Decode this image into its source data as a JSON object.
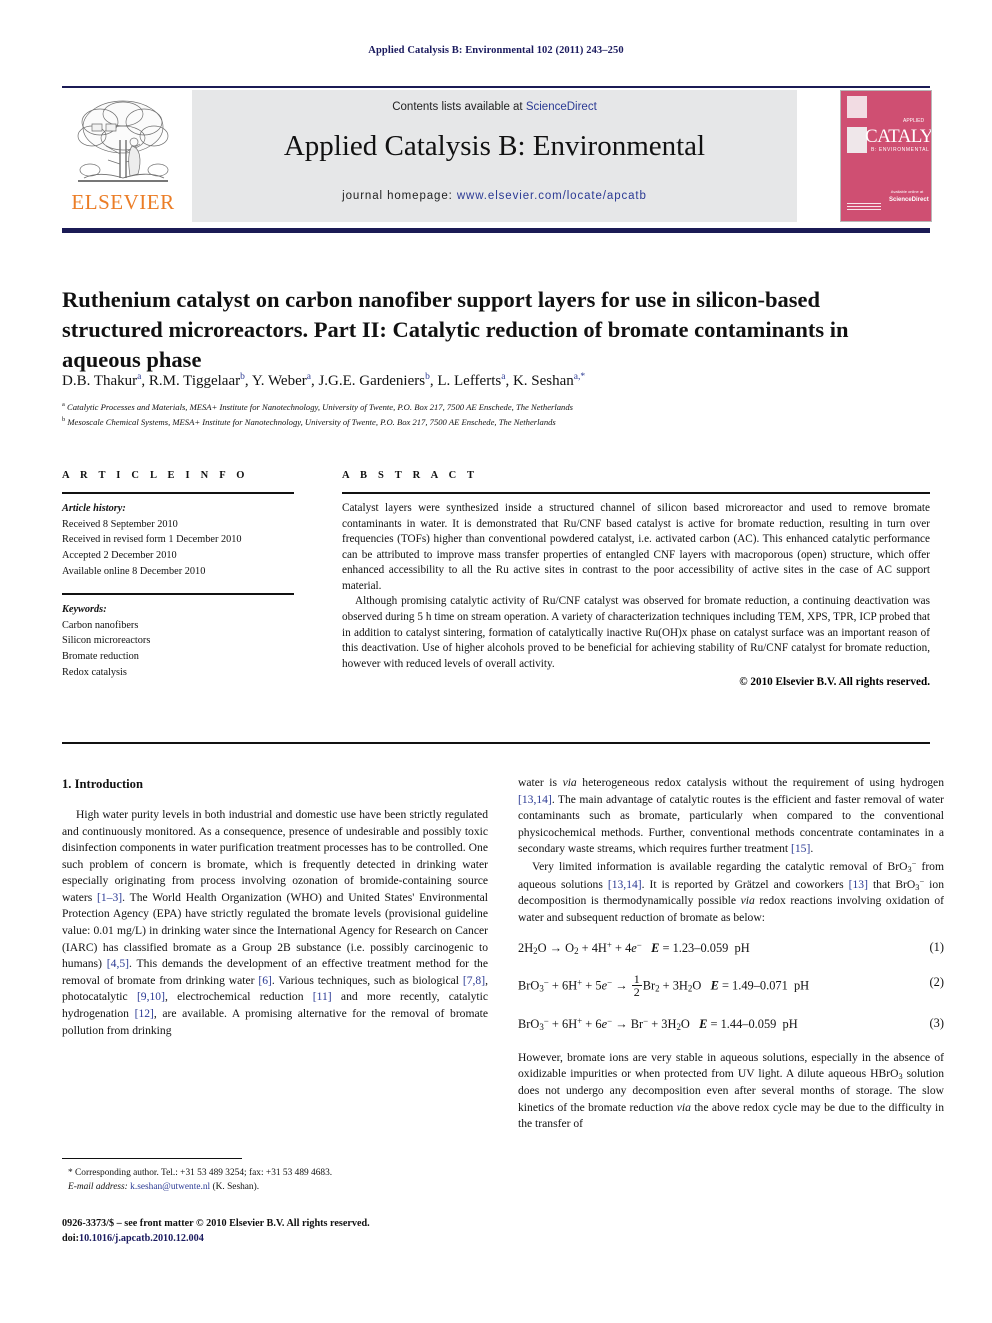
{
  "running_head": "Applied Catalysis B: Environmental 102 (2011) 243–250",
  "masthead": {
    "contents_prefix": "Contents lists available at ",
    "contents_link": "ScienceDirect",
    "journal_title": "Applied Catalysis B: Environmental",
    "homepage_prefix": "journal homepage: ",
    "homepage_url": "www.elsevier.com/locate/apcatb",
    "publisher": "ELSEVIER",
    "cover": {
      "title": "CATALYSIS",
      "applied": "APPLIED",
      "subtitle": "B: ENVIRONMENTAL",
      "available_at": "Available online at",
      "sciencedirect": "ScienceDirect"
    },
    "rule_color": "#1b1b55",
    "band_color": "#e6e7e8",
    "link_color": "#2b3a94",
    "elsevier_orange": "#eb7d26",
    "cover_pink": "#cf4f72"
  },
  "article": {
    "title": "Ruthenium catalyst on carbon nanofiber support layers for use in silicon-based structured microreactors. Part II: Catalytic reduction of bromate contaminants in aqueous phase",
    "authors": [
      {
        "name": "D.B. Thakur",
        "marks": "a"
      },
      {
        "name": "R.M. Tiggelaar",
        "marks": "b"
      },
      {
        "name": "Y. Weber",
        "marks": "a"
      },
      {
        "name": "J.G.E. Gardeniers",
        "marks": "b"
      },
      {
        "name": "L. Lefferts",
        "marks": "a"
      },
      {
        "name": "K. Seshan",
        "marks": "a,*"
      }
    ],
    "affiliations": [
      {
        "mark": "a",
        "text": "Catalytic Processes and Materials, MESA+ Institute for Nanotechnology, University of Twente, P.O. Box 217, 7500 AE Enschede, The Netherlands"
      },
      {
        "mark": "b",
        "text": "Mesoscale Chemical Systems, MESA+ Institute for Nanotechnology, University of Twente, P.O. Box 217, 7500 AE Enschede, The Netherlands"
      }
    ]
  },
  "article_info": {
    "heading": "A R T I C L E  I N F O",
    "history_label": "Article history:",
    "history": [
      "Received 8 September 2010",
      "Received in revised form 1 December 2010",
      "Accepted 2 December 2010",
      "Available online 8 December 2010"
    ],
    "keywords_label": "Keywords:",
    "keywords": [
      "Carbon nanofibers",
      "Silicon microreactors",
      "Bromate reduction",
      "Redox catalysis"
    ]
  },
  "abstract": {
    "heading": "A B S T R A C T",
    "para1": "Catalyst layers were synthesized inside a structured channel of silicon based microreactor and used to remove bromate contaminants in water. It is demonstrated that Ru/CNF based catalyst is active for bromate reduction, resulting in turn over frequencies (TOFs) higher than conventional powdered catalyst, i.e. activated carbon (AC). This enhanced catalytic performance can be attributed to improve mass transfer properties of entangled CNF layers with macroporous (open) structure, which offer enhanced accessibility to all the Ru active sites in contrast to the poor accessibility of active sites in the case of AC support material.",
    "para2": "Although promising catalytic activity of Ru/CNF catalyst was observed for bromate reduction, a continuing deactivation was observed during 5 h time on stream operation. A variety of characterization techniques including TEM, XPS, TPR, ICP probed that in addition to catalyst sintering, formation of catalytically inactive Ru(OH)x phase on catalyst surface was an important reason of this deactivation. Use of higher alcohols proved to be beneficial for achieving stability of Ru/CNF catalyst for bromate reduction, however with reduced levels of overall activity.",
    "copyright": "© 2010 Elsevier B.V. All rights reserved."
  },
  "body": {
    "section_heading": "1.  Introduction",
    "left_para1": "High water purity levels in both industrial and domestic use have been strictly regulated and continuously monitored. As a consequence, presence of undesirable and possibly toxic disinfection components in water purification treatment processes has to be controlled. One such problem of concern is bromate, which is frequently detected in drinking water especially originating from process involving ozonation of bromide-containing source waters [1–3]. The World Health Organization (WHO) and United States' Environmental Protection Agency (EPA) have strictly regulated the bromate levels (provisional guideline value: 0.01 mg/L) in drinking water since the International Agency for Research on Cancer (IARC) has classified bromate as a Group 2B substance (i.e. possibly carcinogenic to humans) [4,5]. This demands the development of an effective treatment method for the removal of bromate from drinking water [6]. Various techniques, such as biological [7,8], photocatalytic [9,10], electrochemical reduction [11] and more recently, catalytic hydrogenation [12], are available. A promising alternative for the removal of bromate pollution from drinking",
    "right_para1": "water is via heterogeneous redox catalysis without the requirement of using hydrogen [13,14]. The main advantage of catalytic routes is the efficient and faster removal of water contaminants such as bromate, particularly when compared to the conventional physicochemical methods. Further, conventional methods concentrate contaminates in a secondary waste streams, which requires further treatment [15].",
    "right_para2": "Very limited information is available regarding the catalytic removal of BrO3− from aqueous solutions [13,14]. It is reported by Grätzel and coworkers [13] that BrO3− ion decomposition is thermodynamically possible via redox reactions involving oxidation of water and subsequent reduction of bromate as below:",
    "right_para3": "However, bromate ions are very stable in aqueous solutions, especially in the absence of oxidizable impurities or when protected from UV light. A dilute aqueous HBrO3 solution does not undergo any decomposition even after several months of storage. The slow kinetics of the bromate reduction via the above redox cycle may be due to the difficulty in the transfer of",
    "equations": [
      {
        "number": "(1)",
        "text": "2H2O → O2 + 4H+ + 4e−   E = 1.23–0.059  pH"
      },
      {
        "number": "(2)",
        "text": "BrO3− + 6H+ + 5e− → ½Br2 + 3H2O   E = 1.49–0.071  pH"
      },
      {
        "number": "(3)",
        "text": "BrO3− + 6H+ + 6e− → Br− + 3H2O   E = 1.44–0.059  pH"
      }
    ]
  },
  "footnotes": {
    "corresponding": "* Corresponding author. Tel.: +31 53 489 3254; fax: +31 53 489 4683.",
    "email_label": "E-mail address:",
    "email": "k.seshan@utwente.nl",
    "email_suffix": "(K. Seshan).",
    "issn_line": "0926-3373/$ – see front matter © 2010 Elsevier B.V. All rights reserved.",
    "doi_prefix": "doi:",
    "doi": "10.1016/j.apcatb.2010.12.004"
  }
}
